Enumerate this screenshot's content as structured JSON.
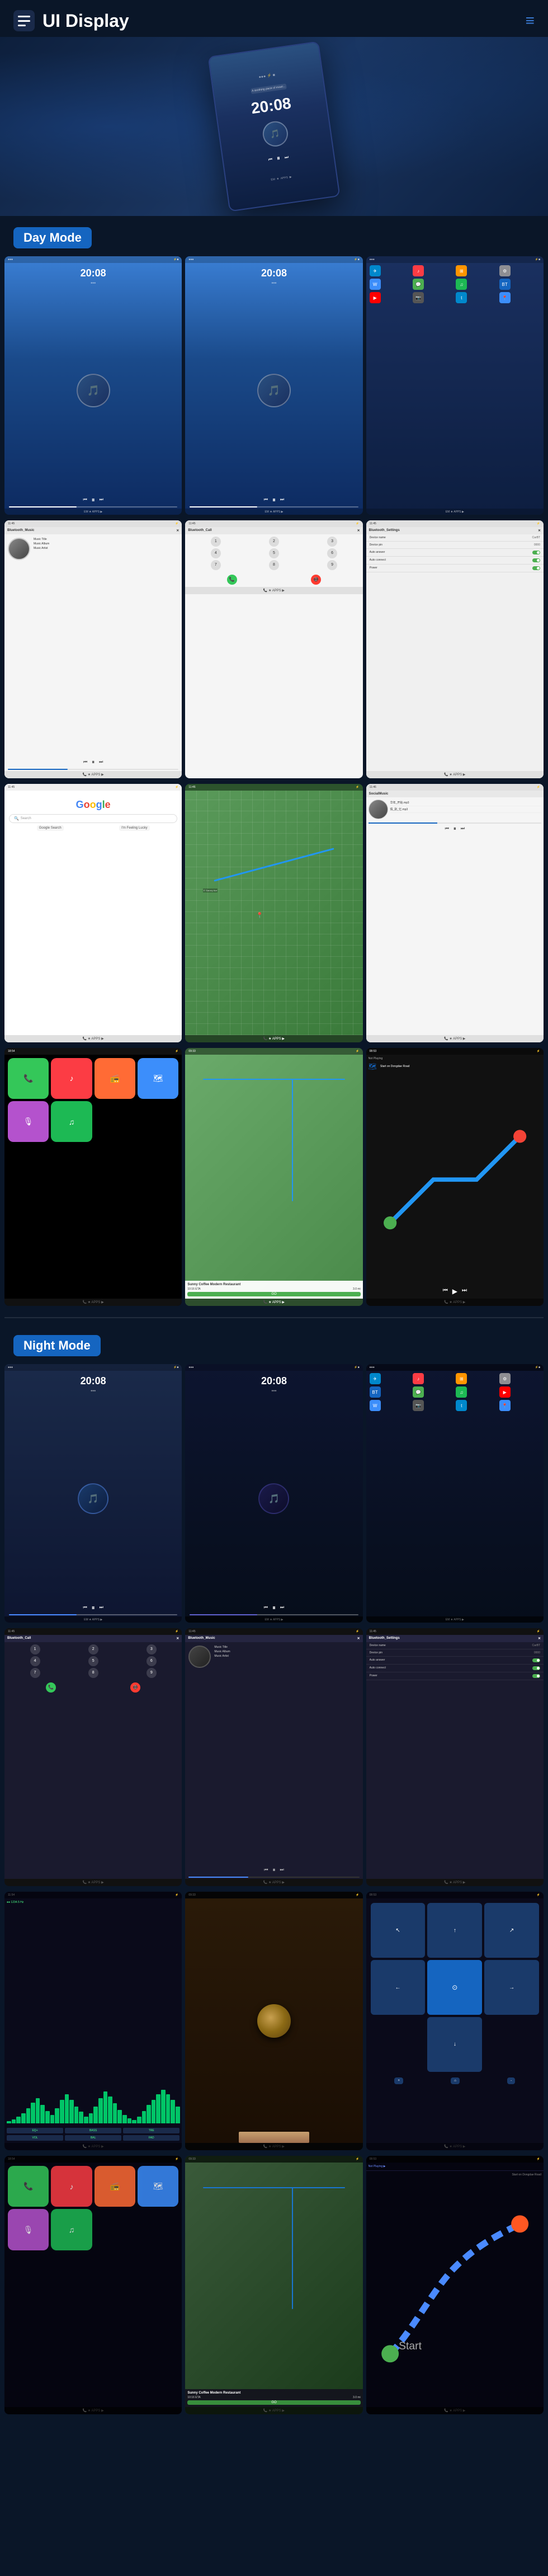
{
  "header": {
    "title": "UI Display",
    "menu_icon": "☰",
    "nav_icon": "≡"
  },
  "sections": [
    {
      "id": "day_mode",
      "label": "Day Mode",
      "color": "#1565c0"
    },
    {
      "id": "night_mode",
      "label": "Night Mode",
      "color": "#1565c0"
    }
  ],
  "day_mode": {
    "screens": [
      {
        "id": "day_home_1",
        "type": "home_day",
        "time": "20:08",
        "subtitle": ""
      },
      {
        "id": "day_home_2",
        "type": "home_day",
        "time": "20:08",
        "subtitle": ""
      },
      {
        "id": "day_apps",
        "type": "apps_day"
      },
      {
        "id": "day_bluetooth_music",
        "type": "bluetooth_music",
        "title": "Bluetooth_Music",
        "track": "Music Title",
        "album": "Music Album",
        "artist": "Music Artist"
      },
      {
        "id": "day_bluetooth_call",
        "type": "bluetooth_call",
        "title": "Bluetooth_Call"
      },
      {
        "id": "day_bluetooth_settings",
        "type": "bluetooth_settings",
        "title": "Bluetooth_Settings"
      },
      {
        "id": "day_google",
        "type": "google"
      },
      {
        "id": "day_map",
        "type": "map"
      },
      {
        "id": "day_social_music",
        "type": "social_music"
      }
    ]
  },
  "landscape_screens": [
    {
      "id": "day_carplay",
      "type": "carplay"
    },
    {
      "id": "day_map_landscape",
      "type": "map_landscape"
    },
    {
      "id": "day_now_playing",
      "type": "now_playing"
    }
  ],
  "night_mode": {
    "screens": [
      {
        "id": "night_home_1",
        "type": "home_night",
        "time": "20:08"
      },
      {
        "id": "night_home_2",
        "type": "home_night_2",
        "time": "20:08"
      },
      {
        "id": "night_apps",
        "type": "apps_night"
      },
      {
        "id": "night_bluetooth_call",
        "type": "bluetooth_call_night",
        "title": "Bluetooth_Call"
      },
      {
        "id": "night_bluetooth_music",
        "type": "bluetooth_music_night",
        "title": "Bluetooth_Music",
        "track": "Music Title",
        "album": "Music Album",
        "artist": "Music Artist"
      },
      {
        "id": "night_bluetooth_settings",
        "type": "bluetooth_settings_night",
        "title": "Bluetooth_Settings"
      },
      {
        "id": "night_waveform",
        "type": "waveform_night"
      },
      {
        "id": "night_food",
        "type": "food_night"
      },
      {
        "id": "night_nav_arrows",
        "type": "nav_arrows_night"
      }
    ]
  },
  "night_landscape": [
    {
      "id": "night_carplay",
      "type": "carplay_night"
    },
    {
      "id": "night_map_landscape",
      "type": "map_landscape_night"
    },
    {
      "id": "night_nav_landscape",
      "type": "nav_landscape_night"
    }
  ],
  "common": {
    "time": "20:08",
    "music_title": "Music Title",
    "music_album": "Music Album",
    "music_artist": "Music Artist",
    "bluetooth_music": "Bluetooth_Music",
    "bluetooth_call": "Bluetooth_Call",
    "bluetooth_settings": "Bluetooth_Settings",
    "device_name_label": "Device name",
    "device_name_value": "CarBT",
    "device_pin_label": "Device pin",
    "device_pin_value": "0000",
    "auto_answer_label": "Auto answer",
    "auto_connect_label": "Auto connect",
    "power_label": "Power",
    "night_mode_label": "Night Mode",
    "day_mode_label": "Day Mode",
    "go_label": "GO",
    "google_label": "Google",
    "sunny_coffee_label": "Sunny Coffee Modern Restaurant",
    "eta_label": "10:16 ETA",
    "distance_label": "3.0 mi",
    "not_playing_label": "Not Playing",
    "start_on_label": "Start on Dongdae Road"
  },
  "waveform_bars": [
    3,
    5,
    8,
    12,
    18,
    25,
    30,
    22,
    15,
    10,
    18,
    28,
    35,
    28,
    20,
    14,
    8,
    12,
    20,
    30,
    38,
    32,
    24,
    16,
    10,
    6,
    4,
    8,
    15,
    22,
    28,
    35,
    40,
    35,
    28,
    20
  ],
  "app_colors": {
    "phone": "#34C759",
    "music": "#FC3C44",
    "maps": "#3C8EFB",
    "messages": "#34C759",
    "podcast": "#B452CD",
    "settings": "#8E8E93",
    "waze": "#3498DB",
    "youtube": "#FF0000",
    "spotify": "#1DB954",
    "telegram": "#0088CC",
    "photos": "#FF9500",
    "camera": "#555"
  }
}
